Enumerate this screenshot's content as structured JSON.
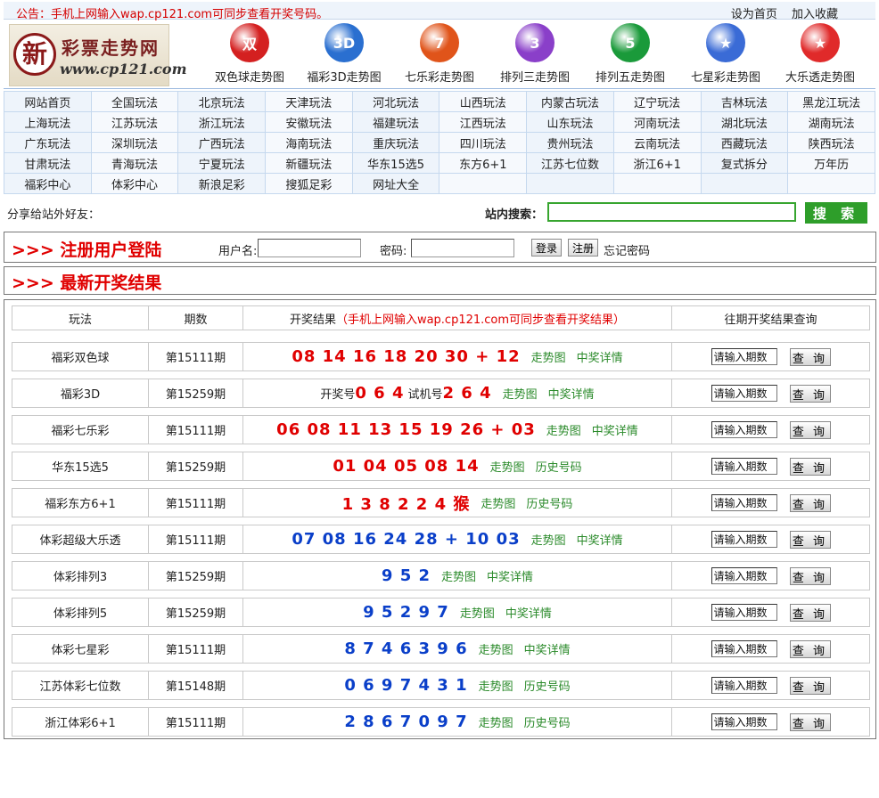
{
  "topbar": {
    "notice": "公告：手机上网输入wap.cp121.com可同步查看开奖号码。",
    "set_home": "设为首页",
    "bookmark": "加入收藏"
  },
  "logo": {
    "char": "新",
    "name": "彩票走势网",
    "url": "www.cp121.com"
  },
  "lotteries": [
    {
      "label": "双色球走势图",
      "icon": "ssq-icon",
      "color": "#d42020",
      "glyph": "双"
    },
    {
      "label": "福彩3D走势图",
      "icon": "fc3d-icon",
      "color": "#2a6fd0",
      "glyph": "3D"
    },
    {
      "label": "七乐彩走势图",
      "icon": "qlc-icon",
      "color": "#e0541a",
      "glyph": "7"
    },
    {
      "label": "排列三走势图",
      "icon": "pl3-icon",
      "color": "#8a3fc9",
      "glyph": "3"
    },
    {
      "label": "排列五走势图",
      "icon": "pl5-icon",
      "color": "#1a9a3a",
      "glyph": "5"
    },
    {
      "label": "七星彩走势图",
      "icon": "qxc-icon",
      "color": "#3a6bd6",
      "glyph": "★"
    },
    {
      "label": "大乐透走势图",
      "icon": "dlt-icon",
      "color": "#e02a2a",
      "glyph": "★"
    }
  ],
  "nav": [
    [
      "网站首页",
      "全国玩法",
      "北京玩法",
      "天津玩法",
      "河北玩法",
      "山西玩法",
      "内蒙古玩法",
      "辽宁玩法",
      "吉林玩法",
      "黑龙江玩法"
    ],
    [
      "上海玩法",
      "江苏玩法",
      "浙江玩法",
      "安徽玩法",
      "福建玩法",
      "江西玩法",
      "山东玩法",
      "河南玩法",
      "湖北玩法",
      "湖南玩法"
    ],
    [
      "广东玩法",
      "深圳玩法",
      "广西玩法",
      "海南玩法",
      "重庆玩法",
      "四川玩法",
      "贵州玩法",
      "云南玩法",
      "西藏玩法",
      "陕西玩法"
    ],
    [
      "甘肃玩法",
      "青海玩法",
      "宁夏玩法",
      "新疆玩法",
      "华东15选5",
      "东方6+1",
      "江苏七位数",
      "浙江6+1",
      "复式拆分",
      "万年历"
    ],
    [
      "福彩中心",
      "体彩中心",
      "新浪足彩",
      "搜狐足彩",
      "网址大全",
      "",
      "",
      "",
      "",
      ""
    ]
  ],
  "share": {
    "label": "分享给站外好友："
  },
  "search": {
    "label": "站内搜索：",
    "value": "",
    "button": "搜 索"
  },
  "login": {
    "title": ">>> 注册用户登陆",
    "username_label": "用户名:",
    "password_label": "密码:",
    "login_btn": "登录",
    "register_btn": "注册",
    "forgot": "忘记密码"
  },
  "results": {
    "title": ">>> 最新开奖结果",
    "headers": {
      "game": "玩法",
      "issue": "期数",
      "result": "开奖结果",
      "result_note": "（手机上网输入wap.cp121.com可同步查看开奖结果）",
      "query": "往期开奖结果查询"
    },
    "query_placeholder": "请输入期数",
    "query_button": "查 询",
    "rows": [
      {
        "game": "福彩双色球",
        "issue": "第15111期",
        "prefix": "",
        "numbers": "08 14 16 18 20 30 + 12",
        "mid": "",
        "numbers2": "",
        "color": "red",
        "link1": "走势图",
        "link2": "中奖详情"
      },
      {
        "game": "福彩3D",
        "issue": "第15259期",
        "prefix": "开奖号",
        "numbers": "0 6 4",
        "mid": "试机号",
        "numbers2": "2 6 4",
        "color": "red",
        "link1": "走势图",
        "link2": "中奖详情"
      },
      {
        "game": "福彩七乐彩",
        "issue": "第15111期",
        "prefix": "",
        "numbers": "06 08 11 13 15 19 26 + 03",
        "mid": "",
        "numbers2": "",
        "color": "red",
        "link1": "走势图",
        "link2": "中奖详情"
      },
      {
        "game": "华东15选5",
        "issue": "第15259期",
        "prefix": "",
        "numbers": "01 04 05 08 14",
        "mid": "",
        "numbers2": "",
        "color": "red",
        "link1": "走势图",
        "link2": "历史号码"
      },
      {
        "game": "福彩东方6+1",
        "issue": "第15111期",
        "prefix": "",
        "numbers": "1 3 8 2 2 4 猴",
        "mid": "",
        "numbers2": "",
        "color": "red",
        "link1": "走势图",
        "link2": "历史号码"
      },
      {
        "game": "体彩超级大乐透",
        "issue": "第15111期",
        "prefix": "",
        "numbers": "07 08 16 24 28 + 10 03",
        "mid": "",
        "numbers2": "",
        "color": "blue",
        "link1": "走势图",
        "link2": "中奖详情"
      },
      {
        "game": "体彩排列3",
        "issue": "第15259期",
        "prefix": "",
        "numbers": "9 5 2",
        "mid": "",
        "numbers2": "",
        "color": "blue",
        "link1": "走势图",
        "link2": "中奖详情"
      },
      {
        "game": "体彩排列5",
        "issue": "第15259期",
        "prefix": "",
        "numbers": "9 5 2 9 7",
        "mid": "",
        "numbers2": "",
        "color": "blue",
        "link1": "走势图",
        "link2": "中奖详情"
      },
      {
        "game": "体彩七星彩",
        "issue": "第15111期",
        "prefix": "",
        "numbers": "8 7 4 6 3 9 6",
        "mid": "",
        "numbers2": "",
        "color": "blue",
        "link1": "走势图",
        "link2": "中奖详情"
      },
      {
        "game": "江苏体彩七位数",
        "issue": "第15148期",
        "prefix": "",
        "numbers": "0 6 9 7 4 3 1",
        "mid": "",
        "numbers2": "",
        "color": "blue",
        "link1": "走势图",
        "link2": "历史号码"
      },
      {
        "game": "浙江体彩6+1",
        "issue": "第15111期",
        "prefix": "",
        "numbers": "2 8 6 7 0 9 7",
        "mid": "",
        "numbers2": "",
        "color": "blue",
        "link1": "走势图",
        "link2": "历史号码"
      }
    ]
  }
}
